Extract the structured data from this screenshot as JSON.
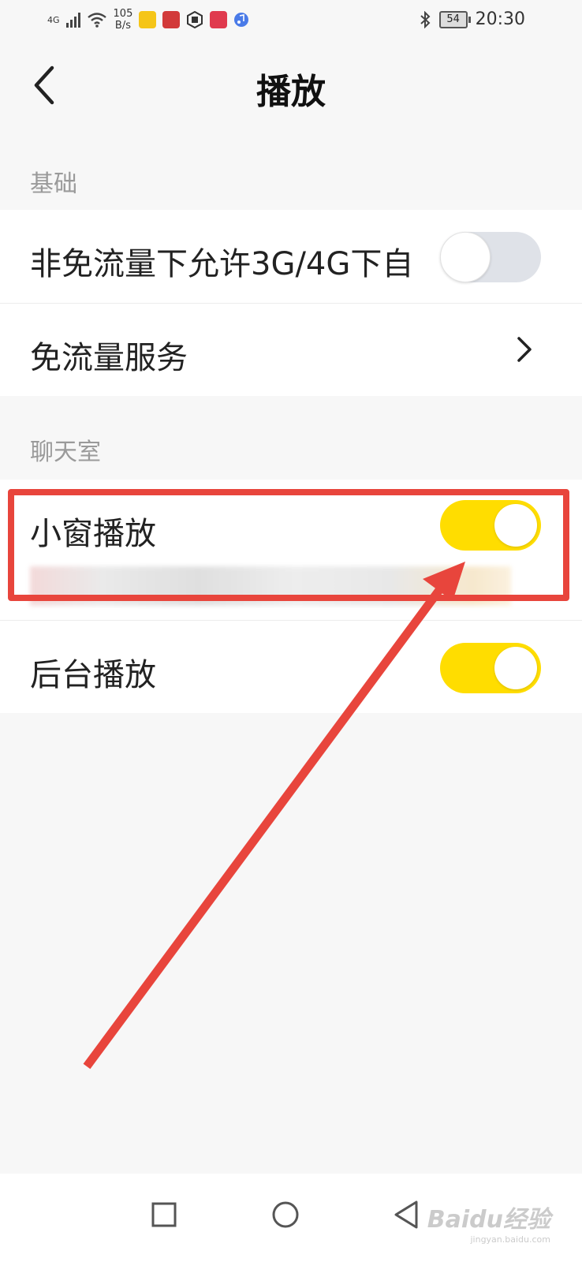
{
  "status_bar": {
    "network_type": "4G",
    "net_speed_value": "105",
    "net_speed_unit": "B/s",
    "battery_level": "54",
    "time": "20:30",
    "app_icons": [
      "app-icon-yellow",
      "app-icon-red",
      "app-icon-hand",
      "app-icon-heart",
      "app-icon-music"
    ]
  },
  "header": {
    "title": "播放",
    "back_icon": "chevron-left-icon"
  },
  "sections": {
    "basic": {
      "label": "基础",
      "rows": {
        "cellular_auto": {
          "label": "非免流量下允许3G/4G下自",
          "toggle_on": false
        },
        "free_data_service": {
          "label": "免流量服务",
          "chevron_icon": "chevron-right-icon"
        }
      }
    },
    "chatroom": {
      "label": "聊天室",
      "rows": {
        "mini_window": {
          "label": "小窗播放",
          "toggle_on": true
        },
        "background_play": {
          "label": "后台播放",
          "toggle_on": true
        }
      }
    }
  },
  "colors": {
    "accent": "#ffdd00",
    "toggle_off": "#dfe2e8",
    "annotation": "#e8453c",
    "background": "#f7f7f7"
  },
  "watermark": {
    "brand": "Baidu经验",
    "site": "jingyan.baidu.com"
  }
}
